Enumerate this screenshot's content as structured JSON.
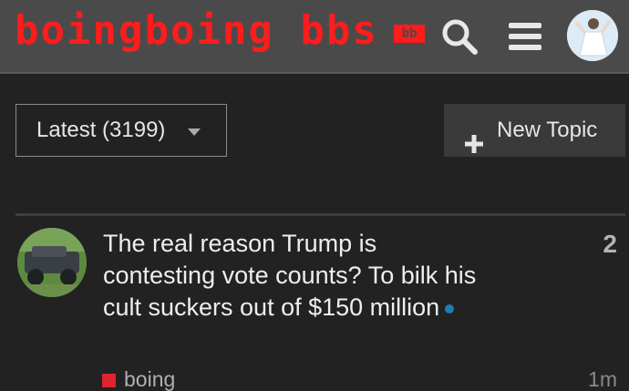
{
  "header": {
    "logo_text": "boingboing bbs",
    "logo_badge": "bb",
    "search_icon": "search-icon",
    "menu_icon": "hamburger-menu-icon",
    "avatar_icon": "user-avatar"
  },
  "controls": {
    "latest_label": "Latest (3199)",
    "new_topic_label": "New Topic"
  },
  "topic": {
    "title": "The real reason Trump is contesting vote counts? To bilk his cult suckers out of $150 million",
    "replies": "2",
    "category": "boing",
    "activity": "1m"
  },
  "colors": {
    "logo": "#ff1c1c",
    "header_bg": "#4a4a4a",
    "page_bg": "#222222",
    "category": "#e0232e",
    "unread": "#1a7fb0"
  }
}
